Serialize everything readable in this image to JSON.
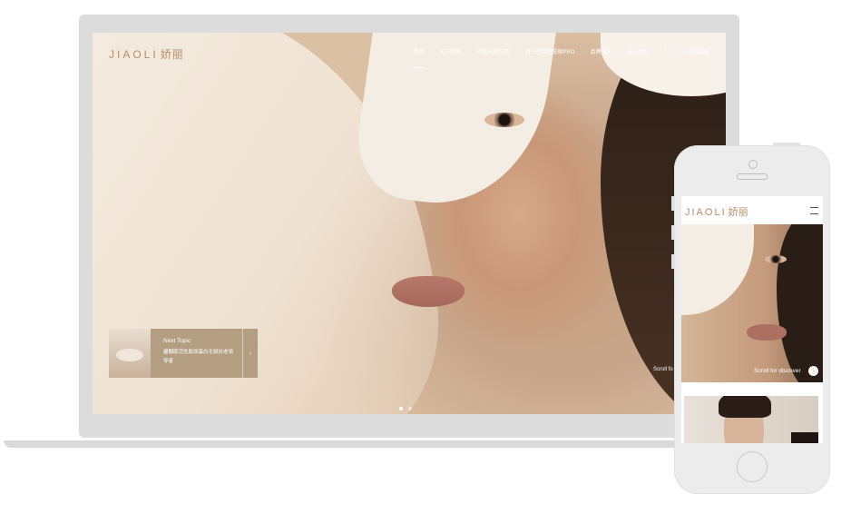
{
  "desktop": {
    "brand_latin": "JIAOLI",
    "brand_cn": "娇丽",
    "nav": [
      {
        "label": "首页",
        "active": true
      },
      {
        "label": "关于娇丽",
        "active": false
      },
      {
        "label": "娇丽无损抗老",
        "active": false
      },
      {
        "label": "新一代活性胶原PRO",
        "active": false
      },
      {
        "label": "品牌资讯",
        "active": false
      },
      {
        "label": "加入我们",
        "active": false
      }
    ],
    "nav_separator": "|",
    "online_store": "在线商城",
    "next_topic": {
      "title": "Next Topic",
      "description": "握翻版活性胶原蛋白无损抗老领导者",
      "arrow": "›"
    },
    "scroll_hint": "Scroll fo",
    "slides_total": 2,
    "slide_active": 1
  },
  "mobile": {
    "brand_latin": "JIAOLI",
    "brand_cn": "娇丽",
    "scroll_hint": "Scroll for discover",
    "scroll_icon": "↓"
  },
  "colors": {
    "brand_gold": "#b58e68",
    "next_topic_bg": "#b39e82",
    "device_gray": "#dcdcdc"
  }
}
